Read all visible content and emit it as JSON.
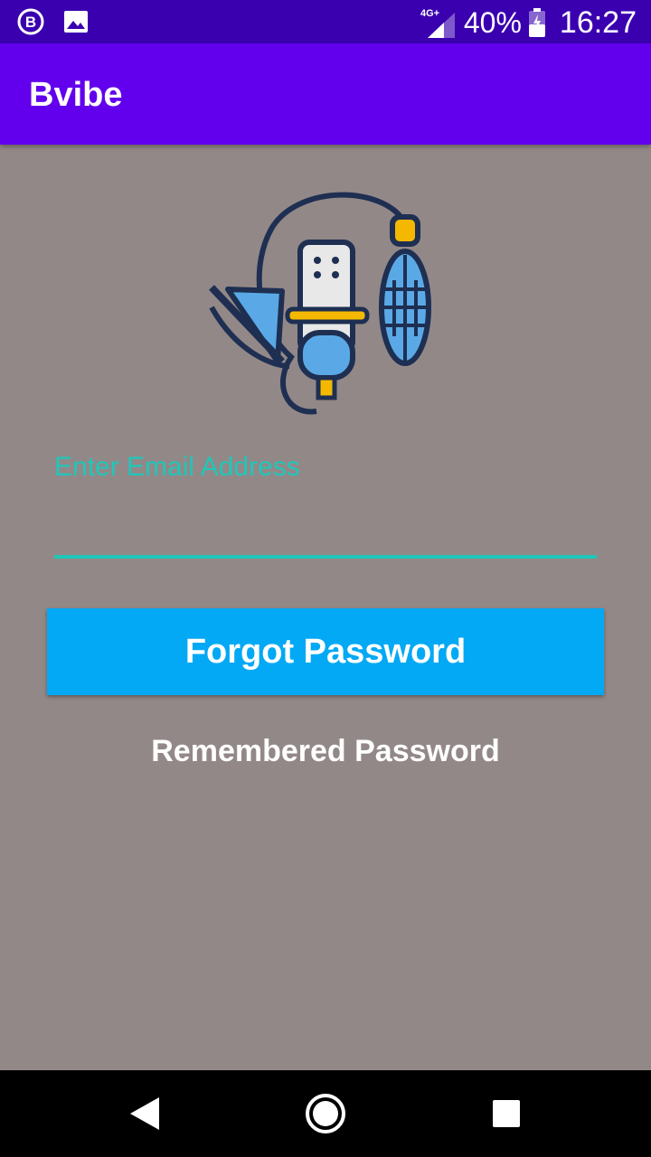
{
  "status_bar": {
    "network_label": "4G+",
    "battery_percent": "40%",
    "time": "16:27",
    "icons": [
      "b-icon",
      "image-icon",
      "signal-icon",
      "battery-icon"
    ]
  },
  "app_bar": {
    "title": "Bvibe"
  },
  "logo": {
    "icon": "microphone-logo-icon"
  },
  "form": {
    "email_placeholder": "Enter Email Address",
    "email_value": "",
    "forgot_button": "Forgot Password",
    "remembered_link": "Remembered Password"
  },
  "nav": {
    "icons": [
      "back-icon",
      "home-icon",
      "recents-icon"
    ]
  },
  "colors": {
    "status_bar": "#3a00b0",
    "app_bar": "#6200ee",
    "background": "#938888",
    "accent": "#1fc7b9",
    "button": "#03a9f4"
  }
}
